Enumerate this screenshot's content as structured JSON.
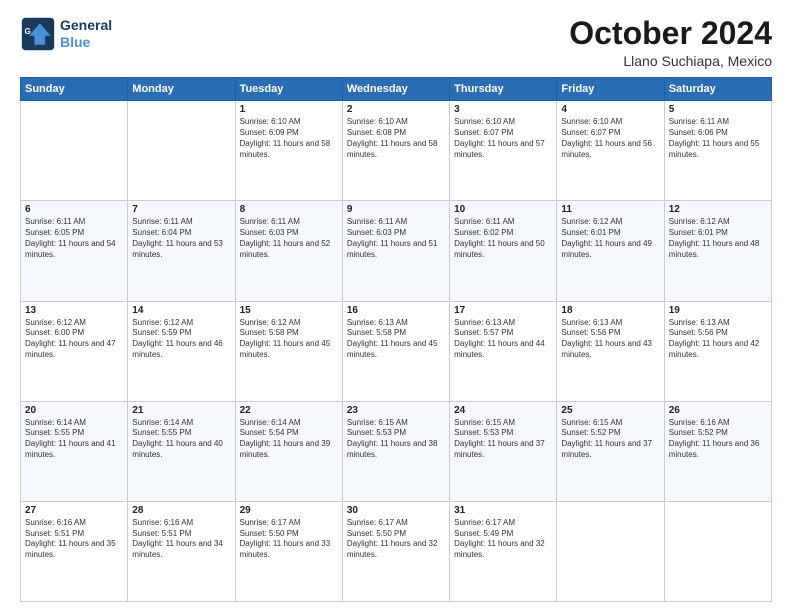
{
  "header": {
    "logo_line1": "General",
    "logo_line2": "Blue",
    "main_title": "October 2024",
    "subtitle": "Llano Suchiapa, Mexico"
  },
  "weekdays": [
    "Sunday",
    "Monday",
    "Tuesday",
    "Wednesday",
    "Thursday",
    "Friday",
    "Saturday"
  ],
  "weeks": [
    [
      {
        "day": "",
        "empty": true
      },
      {
        "day": "",
        "empty": true
      },
      {
        "day": "1",
        "sunrise": "6:10 AM",
        "sunset": "6:09 PM",
        "daylight": "11 hours and 58 minutes."
      },
      {
        "day": "2",
        "sunrise": "6:10 AM",
        "sunset": "6:08 PM",
        "daylight": "11 hours and 58 minutes."
      },
      {
        "day": "3",
        "sunrise": "6:10 AM",
        "sunset": "6:07 PM",
        "daylight": "11 hours and 57 minutes."
      },
      {
        "day": "4",
        "sunrise": "6:10 AM",
        "sunset": "6:07 PM",
        "daylight": "11 hours and 56 minutes."
      },
      {
        "day": "5",
        "sunrise": "6:11 AM",
        "sunset": "6:06 PM",
        "daylight": "11 hours and 55 minutes."
      }
    ],
    [
      {
        "day": "6",
        "sunrise": "6:11 AM",
        "sunset": "6:05 PM",
        "daylight": "11 hours and 54 minutes."
      },
      {
        "day": "7",
        "sunrise": "6:11 AM",
        "sunset": "6:04 PM",
        "daylight": "11 hours and 53 minutes."
      },
      {
        "day": "8",
        "sunrise": "6:11 AM",
        "sunset": "6:03 PM",
        "daylight": "11 hours and 52 minutes."
      },
      {
        "day": "9",
        "sunrise": "6:11 AM",
        "sunset": "6:03 PM",
        "daylight": "11 hours and 51 minutes."
      },
      {
        "day": "10",
        "sunrise": "6:11 AM",
        "sunset": "6:02 PM",
        "daylight": "11 hours and 50 minutes."
      },
      {
        "day": "11",
        "sunrise": "6:12 AM",
        "sunset": "6:01 PM",
        "daylight": "11 hours and 49 minutes."
      },
      {
        "day": "12",
        "sunrise": "6:12 AM",
        "sunset": "6:01 PM",
        "daylight": "11 hours and 48 minutes."
      }
    ],
    [
      {
        "day": "13",
        "sunrise": "6:12 AM",
        "sunset": "6:00 PM",
        "daylight": "11 hours and 47 minutes."
      },
      {
        "day": "14",
        "sunrise": "6:12 AM",
        "sunset": "5:59 PM",
        "daylight": "11 hours and 46 minutes."
      },
      {
        "day": "15",
        "sunrise": "6:12 AM",
        "sunset": "5:58 PM",
        "daylight": "11 hours and 45 minutes."
      },
      {
        "day": "16",
        "sunrise": "6:13 AM",
        "sunset": "5:58 PM",
        "daylight": "11 hours and 45 minutes."
      },
      {
        "day": "17",
        "sunrise": "6:13 AM",
        "sunset": "5:57 PM",
        "daylight": "11 hours and 44 minutes."
      },
      {
        "day": "18",
        "sunrise": "6:13 AM",
        "sunset": "5:56 PM",
        "daylight": "11 hours and 43 minutes."
      },
      {
        "day": "19",
        "sunrise": "6:13 AM",
        "sunset": "5:56 PM",
        "daylight": "11 hours and 42 minutes."
      }
    ],
    [
      {
        "day": "20",
        "sunrise": "6:14 AM",
        "sunset": "5:55 PM",
        "daylight": "11 hours and 41 minutes."
      },
      {
        "day": "21",
        "sunrise": "6:14 AM",
        "sunset": "5:55 PM",
        "daylight": "11 hours and 40 minutes."
      },
      {
        "day": "22",
        "sunrise": "6:14 AM",
        "sunset": "5:54 PM",
        "daylight": "11 hours and 39 minutes."
      },
      {
        "day": "23",
        "sunrise": "6:15 AM",
        "sunset": "5:53 PM",
        "daylight": "11 hours and 38 minutes."
      },
      {
        "day": "24",
        "sunrise": "6:15 AM",
        "sunset": "5:53 PM",
        "daylight": "11 hours and 37 minutes."
      },
      {
        "day": "25",
        "sunrise": "6:15 AM",
        "sunset": "5:52 PM",
        "daylight": "11 hours and 37 minutes."
      },
      {
        "day": "26",
        "sunrise": "6:16 AM",
        "sunset": "5:52 PM",
        "daylight": "11 hours and 36 minutes."
      }
    ],
    [
      {
        "day": "27",
        "sunrise": "6:16 AM",
        "sunset": "5:51 PM",
        "daylight": "11 hours and 35 minutes."
      },
      {
        "day": "28",
        "sunrise": "6:16 AM",
        "sunset": "5:51 PM",
        "daylight": "11 hours and 34 minutes."
      },
      {
        "day": "29",
        "sunrise": "6:17 AM",
        "sunset": "5:50 PM",
        "daylight": "11 hours and 33 minutes."
      },
      {
        "day": "30",
        "sunrise": "6:17 AM",
        "sunset": "5:50 PM",
        "daylight": "11 hours and 32 minutes."
      },
      {
        "day": "31",
        "sunrise": "6:17 AM",
        "sunset": "5:49 PM",
        "daylight": "11 hours and 32 minutes."
      },
      {
        "day": "",
        "empty": true
      },
      {
        "day": "",
        "empty": true
      }
    ]
  ]
}
